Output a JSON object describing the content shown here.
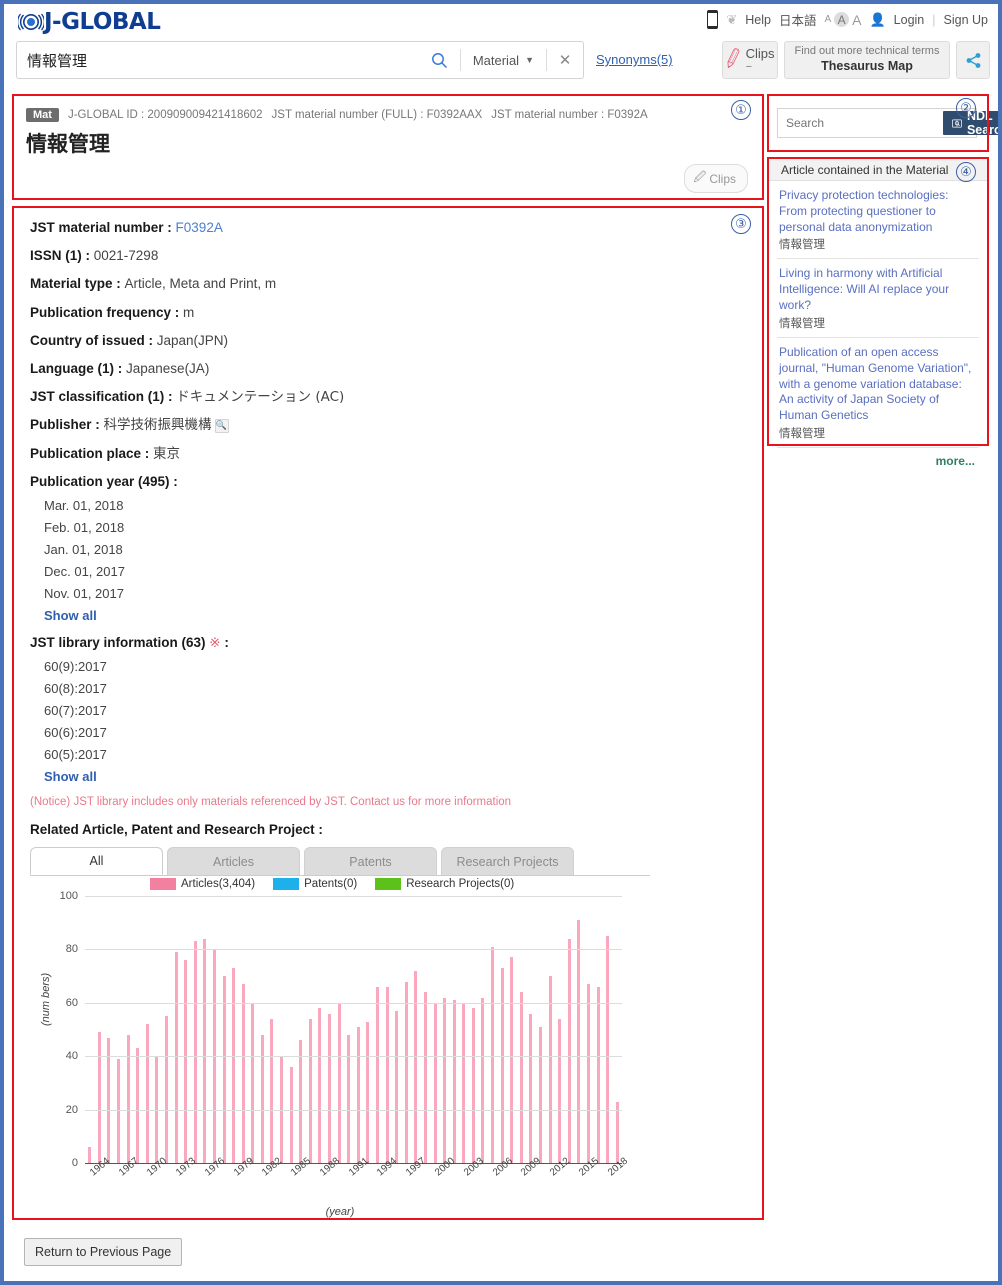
{
  "header": {
    "brand": "J-GLOBAL",
    "phone_icon": "mobile-icon",
    "help": "Help",
    "lang": "日本語",
    "font_small": "A",
    "font_medium": "A",
    "font_large": "A",
    "login": "Login",
    "signup": "Sign Up",
    "divider": "|"
  },
  "search": {
    "value": "情報管理",
    "placeholder": "",
    "category": "Material",
    "caret": "▼",
    "clear": "✕",
    "synonyms": "Synonyms(5)",
    "clips_label": "Clips",
    "clips_count": "−",
    "thesaurus_top": "Find out more technical terms",
    "thesaurus_bottom": "Thesaurus Map"
  },
  "annotations": {
    "n1": "①",
    "n2": "②",
    "n3": "③",
    "n4": "④"
  },
  "title_block": {
    "badge": "Mat",
    "id_label": "J-GLOBAL ID : 200909009421418602",
    "full_number": "JST material number (FULL) : F0392AAX",
    "short_number": "JST material number : F0392A",
    "title": "情報管理",
    "clips_pill": "Clips"
  },
  "detail": {
    "fields": [
      {
        "label": "JST material number : ",
        "value": "F0392A",
        "link": true
      },
      {
        "label": "ISSN (1) : ",
        "value": "0021-7298",
        "link": false
      },
      {
        "label": "Material type : ",
        "value": "Article, Meta and Print, m",
        "link": false
      },
      {
        "label": "Publication frequency : ",
        "value": "m",
        "link": false
      },
      {
        "label": "Country of issued : ",
        "value": "Japan(JPN)",
        "link": false
      },
      {
        "label": "Language (1) : ",
        "value": "Japanese(JA)",
        "link": false
      },
      {
        "label": "JST classification (1) : ",
        "value": "ドキュメンテーション (AC)",
        "link": false
      },
      {
        "label": "Publisher : ",
        "value": "科学技術振興機構",
        "link": false,
        "search_icon": true
      },
      {
        "label": "Publication place : ",
        "value": "東京",
        "link": false
      }
    ],
    "publication_year_label": "Publication year (495) : ",
    "publication_years": [
      "Mar. 01, 2018",
      "Feb. 01, 2018",
      "Jan. 01, 2018",
      "Dec. 01, 2017",
      "Nov. 01, 2017"
    ],
    "show_all_1": "Show all",
    "library_label": "JST library information (63) ",
    "library_asterisk": "※",
    "library_colon": " : ",
    "library_items": [
      "60(9):2017",
      "60(8):2017",
      "60(7):2017",
      "60(6):2017",
      "60(5):2017"
    ],
    "show_all_2": "Show all",
    "notice_text": "(Notice) JST library includes only materials referenced by JST. ",
    "notice_link": "Contact us for more information",
    "related_header": "Related Article, Patent and Research Project :",
    "tabs": [
      {
        "label": "All",
        "active": true
      },
      {
        "label": "Articles",
        "active": false
      },
      {
        "label": "Patents",
        "active": false
      },
      {
        "label": "Research Projects",
        "active": false
      }
    ]
  },
  "chart_data": {
    "type": "bar",
    "title": "",
    "xlabel": "(year)",
    "ylabel": "(num bers)",
    "ylim": [
      0,
      100
    ],
    "yticks": [
      0,
      20,
      40,
      60,
      80,
      100
    ],
    "grid": true,
    "legend_position": "top",
    "legend": [
      {
        "name": "Articles(3,404)",
        "color": "#f4809f"
      },
      {
        "name": "Patents(0)",
        "color": "#1eb0ea"
      },
      {
        "name": "Research Projects(0)",
        "color": "#5cc11a"
      }
    ],
    "xtick_labels": [
      "1964",
      "1967",
      "1970",
      "1973",
      "1976",
      "1979",
      "1982",
      "1985",
      "1988",
      "1991",
      "1994",
      "1997",
      "2000",
      "2003",
      "2006",
      "2009",
      "2012",
      "2015",
      "2018"
    ],
    "categories": [
      1964,
      1965,
      1966,
      1967,
      1968,
      1969,
      1970,
      1971,
      1972,
      1973,
      1974,
      1975,
      1976,
      1977,
      1978,
      1979,
      1980,
      1981,
      1982,
      1983,
      1984,
      1985,
      1986,
      1987,
      1988,
      1989,
      1990,
      1991,
      1992,
      1993,
      1994,
      1995,
      1996,
      1997,
      1998,
      1999,
      2000,
      2001,
      2002,
      2003,
      2004,
      2005,
      2006,
      2007,
      2008,
      2009,
      2010,
      2011,
      2012,
      2013,
      2014,
      2015,
      2016,
      2017,
      2018,
      2019
    ],
    "series": [
      {
        "name": "Articles(3,404)",
        "color": "#f9a8bd",
        "values": [
          6,
          49,
          47,
          39,
          48,
          43,
          52,
          40,
          55,
          79,
          76,
          83,
          84,
          80,
          70,
          73,
          67,
          60,
          48,
          54,
          40,
          36,
          46,
          54,
          58,
          56,
          60,
          48,
          51,
          53,
          66,
          66,
          57,
          68,
          72,
          64,
          60,
          62,
          61,
          60,
          58,
          62,
          81,
          73,
          77,
          64,
          56,
          51,
          70,
          54,
          84,
          91,
          67,
          66,
          85,
          23
        ]
      },
      {
        "name": "Patents(0)",
        "color": "#1eb0ea",
        "values": []
      },
      {
        "name": "Research Projects(0)",
        "color": "#5cc11a",
        "values": []
      }
    ]
  },
  "ndl": {
    "placeholder": "Search",
    "button": "NDL Search",
    "icon": "book-search-icon"
  },
  "articles_panel": {
    "caption": "Article contained in the Material",
    "items": [
      {
        "title": "Privacy protection technologies: From protecting questioner to personal data anonymization",
        "source": "情報管理"
      },
      {
        "title": "Living in harmony with Artificial Intelligence: Will AI replace your work?",
        "source": "情報管理"
      },
      {
        "title": "Publication of an open access journal, \"Human Genome Variation\", with a genome variation database: An activity of Japan Society of Human Genetics",
        "source": "情報管理"
      }
    ],
    "more": "more..."
  },
  "footer": {
    "return_button": "Return to Previous Page"
  }
}
